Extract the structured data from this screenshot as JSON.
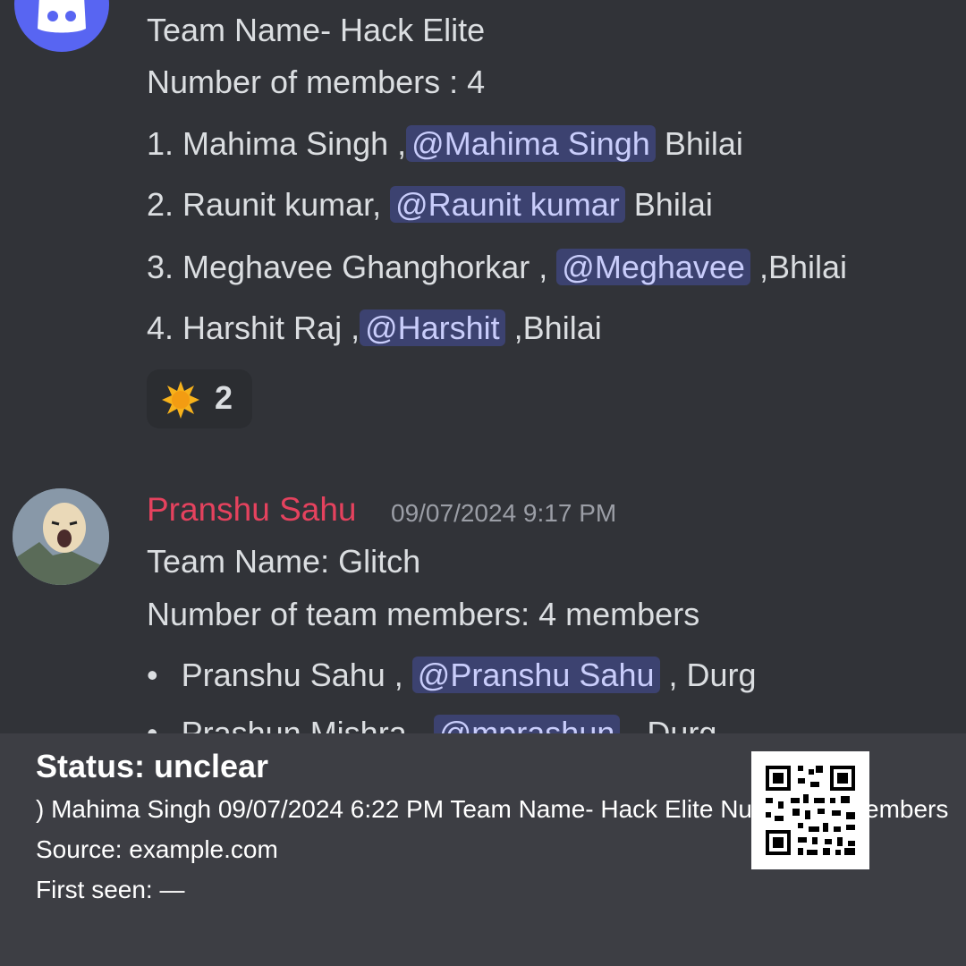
{
  "message1": {
    "lines": [
      "Team Name- Hack Elite",
      "Number of members : 4"
    ],
    "members": [
      {
        "before": "1. Mahima Singh ,",
        "mention": "@Mahima Singh",
        "after": " Bhilai"
      },
      {
        "before": "2. Raunit kumar, ",
        "mention": "@Raunit kumar",
        "after": " Bhilai"
      },
      {
        "before": "3. Meghavee Ghanghorkar , ",
        "mention": "@Meghavee",
        "after": " ,Bhilai"
      },
      {
        "before": "4. Harshit Raj ,",
        "mention": "@Harshit",
        "after": " ,Bhilai"
      }
    ],
    "reaction": {
      "icon": "sun-emoji",
      "count": "2"
    }
  },
  "message2": {
    "author": "Pranshu Sahu",
    "author_color": "#e5425e",
    "timestamp": "09/07/2024 9:17 PM",
    "lines": [
      "Team Name: Glitch",
      "Number of team members: 4 members"
    ],
    "members": [
      {
        "before": "Pranshu Sahu , ",
        "mention": "@Pranshu Sahu",
        "after": " , Durg"
      },
      {
        "before": "Prashun Mishra , ",
        "mention": "@mprashun",
        "after": " , Durg"
      }
    ]
  },
  "footer": {
    "status": "Status: unclear",
    "caption": ") Mahima Singh 09/07/2024 6:22 PM Team Name- Hack Elite Number of members",
    "source": "Source: example.com",
    "first_seen": "First seen: —"
  },
  "colors": {
    "background": "#313338",
    "mention_bg": "#3c4270",
    "mention_text": "#c9cdfb",
    "footer_bg": "#3d3e44",
    "discord_blurple": "#5865f2"
  }
}
